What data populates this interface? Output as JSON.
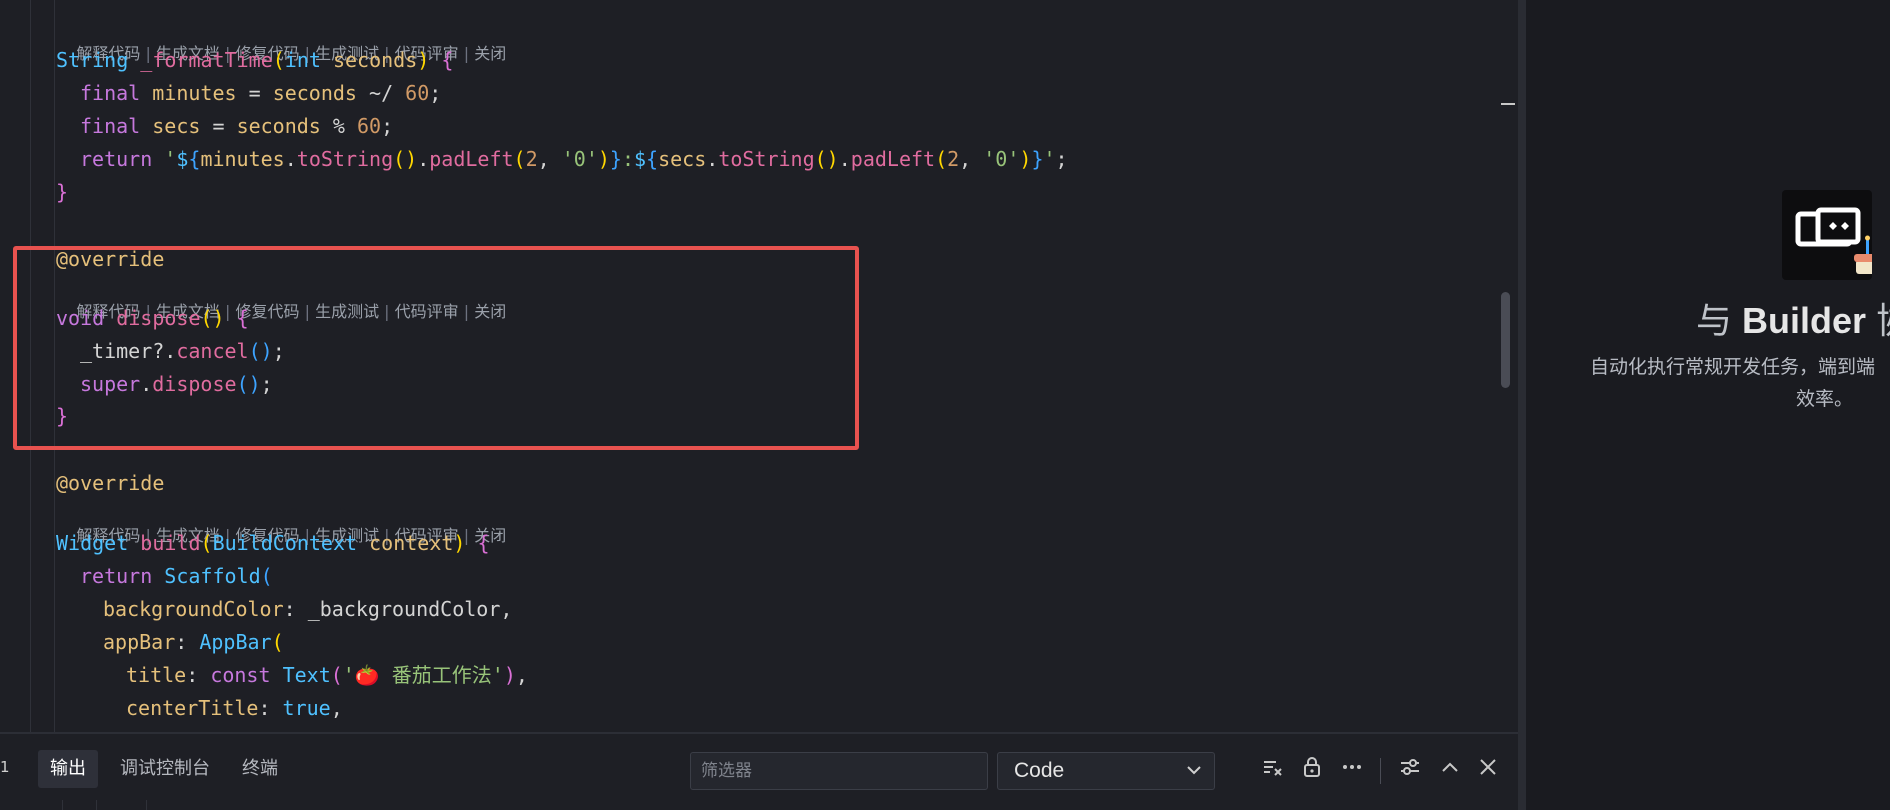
{
  "code_lens": {
    "explain": "解释代码",
    "docs": "生成文档",
    "fix": "修复代码",
    "test": "生成测试",
    "review": "代码评审",
    "close": "关闭",
    "separator": " | "
  },
  "code": {
    "l1": {
      "kw": "String",
      "fn": "_formatTime",
      "p1": "(",
      "ty": "int",
      "arg": "seconds",
      "p2": ")",
      "b": "{"
    },
    "l2": {
      "kw": "final",
      "v": "minutes",
      "op": " = ",
      "a": "seconds",
      "op2": " ~/ ",
      "n": "60",
      "e": ";"
    },
    "l3": {
      "kw": "final",
      "v": "secs",
      "op": " = ",
      "a": "seconds",
      "op2": " % ",
      "n": "60",
      "e": ";"
    },
    "l4": {
      "kw": "return",
      "q": "'",
      "d1": "$",
      "b1": "{",
      "v1": "minutes",
      "m1": ".",
      "f1": "toString",
      "p1": "()",
      "m2": ".",
      "f2": "padLeft",
      "p2": "(",
      "n1": "2",
      "c1": ", ",
      "s1": "'0'",
      "p3": ")",
      "b2": "}",
      "colon": ":",
      "d2": "$",
      "b3": "{",
      "v2": "secs",
      "m3": ".",
      "f3": "toString",
      "p4": "()",
      "m4": ".",
      "f4": "padLeft",
      "p5": "(",
      "n2": "2",
      "c2": ", ",
      "s2": "'0'",
      "p6": ")",
      "b4": "}",
      "q2": "'",
      "e": ";"
    },
    "l5": {
      "b": "}"
    },
    "l6": {
      "an": "@override"
    },
    "l7": {
      "kw": "void",
      "fn": "dispose",
      "p": "()",
      "b": "{"
    },
    "l8": {
      "v": "_timer",
      "op": "?.",
      "fn": "cancel",
      "p": "()",
      "e": ";"
    },
    "l9": {
      "kw": "super",
      "op": ".",
      "fn": "dispose",
      "p": "()",
      "e": ";"
    },
    "l10": {
      "b": "}"
    },
    "l11": {
      "an": "@override"
    },
    "l12": {
      "ty": "Widget",
      "fn": "build",
      "p1": "(",
      "ty2": "BuildContext",
      "arg": "context",
      "p2": ")",
      "b": "{"
    },
    "l13": {
      "kw": "return",
      "ty": "Scaffold",
      "p": "("
    },
    "l14": {
      "k": "backgroundColor",
      "c": ": ",
      "v": "_backgroundColor",
      "e": ","
    },
    "l15": {
      "k": "appBar",
      "c": ": ",
      "ty": "AppBar",
      "p": "("
    },
    "l16": {
      "k": "title",
      "c": ": ",
      "kw": "const",
      "ty": "Text",
      "p": "(",
      "s": "'🍅 番茄工作法'",
      "p2": ")",
      "e": ","
    },
    "l17": {
      "k": "centerTitle",
      "c": ": ",
      "kw": "true",
      "e": ","
    }
  },
  "right_panel": {
    "title_prefix": "与",
    "title_main": "Builder",
    "title_cut": "协",
    "description_line1": "自动化执行常规开发任务，端到端",
    "description_line2": "效率。",
    "logo_icon": "builder-robot-icon"
  },
  "bottom_panel": {
    "count": "1",
    "tabs": [
      "输出",
      "调试控制台",
      "终端"
    ],
    "active_tab": "输出",
    "filter_placeholder": "筛选器",
    "channel": "Code",
    "icons": [
      "clear-output-icon",
      "lock-icon",
      "more-icon",
      "settings-icon",
      "chevron-up-icon",
      "close-icon"
    ]
  },
  "colors": {
    "highlight_border": "#e8524f",
    "editor_bg": "#1e1f25"
  }
}
